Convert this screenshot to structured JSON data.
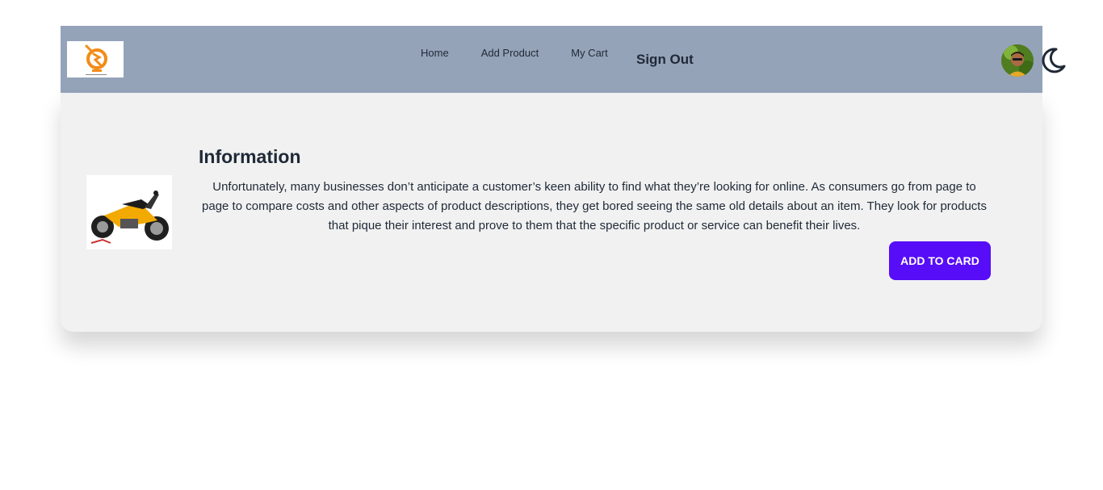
{
  "navbar": {
    "links": [
      {
        "label": "Home"
      },
      {
        "label": "Add Product"
      },
      {
        "label": "My Cart"
      }
    ],
    "signout_label": "Sign Out",
    "background": "#94a3b8",
    "icons": {
      "logo": "brand-logo",
      "avatar": "user-avatar",
      "theme_toggle": "moon-icon"
    }
  },
  "product_card": {
    "title": "Information",
    "description": "Unfortunately, many businesses don’t anticipate a customer’s keen ability to find what they’re looking for online. As consumers go from page to page to compare costs and other aspects of product descriptions, they get bored seeing the same old details about an item. They look for products that pique their interest and prove to them that the specific product or service can benefit their lives.",
    "button_label": "ADD TO CARD",
    "button_color": "#570df8",
    "image": "motorcycle-image"
  }
}
